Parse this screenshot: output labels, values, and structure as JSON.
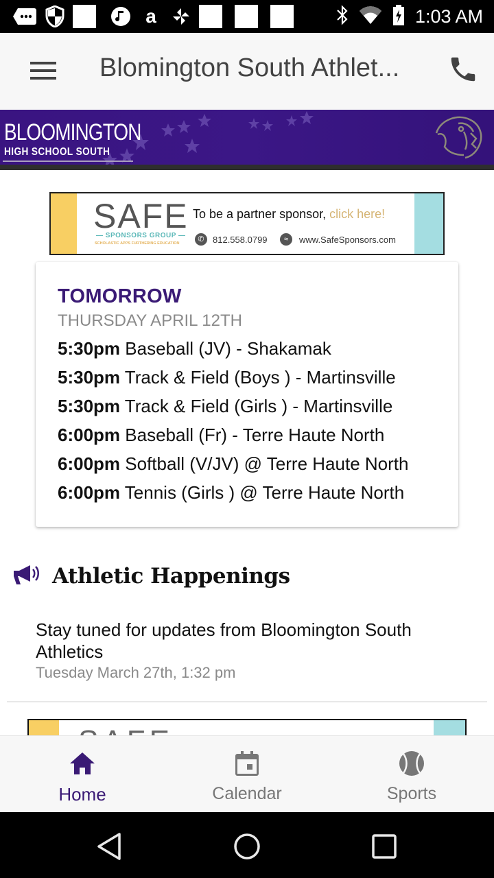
{
  "status_bar": {
    "time": "1:03 AM",
    "left_icons": [
      "messages-icon",
      "shield-icon",
      "notification-placeholder",
      "music-icon",
      "amazon-icon",
      "pinwheel-icon",
      "notification-placeholder",
      "notification-placeholder",
      "notification-placeholder"
    ],
    "right_icons": [
      "bluetooth-icon",
      "wifi-icon",
      "battery-charging-icon"
    ]
  },
  "app_bar": {
    "title": "Blomington South Athlet...",
    "menu_icon": "menu-icon",
    "action_icon": "phone-icon"
  },
  "banner": {
    "title": "BLOOMINGTON",
    "subtitle": "HIGH SCHOOL SOUTH",
    "logo": "panther-mascot",
    "colors": {
      "background": "#3a1481",
      "text": "#ffffff"
    }
  },
  "sponsor_ad": {
    "logo_text": "SAFE",
    "logo_sub": "— SPONSORS GROUP —",
    "logo_tagline": "SCHOLASTIC APPS FURTHERING EDUCATION",
    "tagline_prefix": "To be a partner sponsor, ",
    "tagline_link": "click here!",
    "phone": "812.558.0799",
    "website": "www.SafeSponsors.com",
    "colors": {
      "left_stripe": "#f8cf63",
      "right_stripe": "#a4dde1",
      "link": "#d5b474"
    }
  },
  "events_card": {
    "heading": "TOMORROW",
    "date": "THURSDAY APRIL 12TH",
    "events": [
      {
        "time": "5:30pm",
        "description": " Baseball (JV) - Shakamak"
      },
      {
        "time": "5:30pm",
        "description": " Track & Field (Boys ) - Martinsville"
      },
      {
        "time": "5:30pm",
        "description": " Track & Field (Girls ) - Martinsville"
      },
      {
        "time": "6:00pm",
        "description": " Baseball (Fr) - Terre Haute North"
      },
      {
        "time": "6:00pm",
        "description": " Softball (V/JV) @ Terre Haute North"
      },
      {
        "time": "6:00pm",
        "description": " Tennis (Girls ) @ Terre Haute North"
      }
    ],
    "accent_color": "#3a1a75"
  },
  "happenings": {
    "title": "Athletic Happenings",
    "icon": "megaphone-icon",
    "items": [
      {
        "text": "Stay tuned for updates from Bloomington South Athletics",
        "date": "Tuesday March 27th, 1:32 pm"
      }
    ]
  },
  "sponsor_ad_2": {
    "logo_text": "SAFE"
  },
  "bottom_nav": {
    "items": [
      {
        "label": "Home",
        "icon": "home-icon",
        "active": true
      },
      {
        "label": "Calendar",
        "icon": "calendar-icon",
        "active": false
      },
      {
        "label": "Sports",
        "icon": "tennis-ball-icon",
        "active": false
      }
    ],
    "active_color": "#3a1a75",
    "inactive_color": "#777777"
  },
  "system_nav": {
    "buttons": [
      "back",
      "home",
      "recents"
    ]
  }
}
